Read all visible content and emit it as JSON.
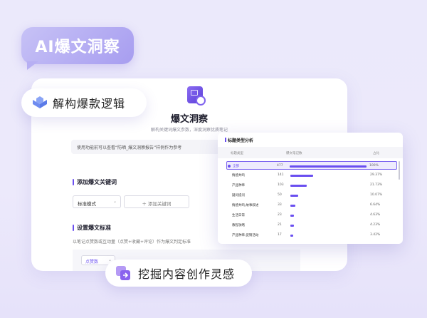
{
  "tag": {
    "label": "AI爆文洞察"
  },
  "pills": {
    "deconstruct": "解构爆款逻辑",
    "mine": "挖掘内容创作灵感"
  },
  "app": {
    "title": "爆文洞察",
    "subtitle": "解构关键词爆文参数，深度洞察优质笔记",
    "notice": "使用功能前可以查看“防晒_爆文洞察报告”样例作为参考",
    "section_keyword": "添加爆文关键词",
    "mode_select": "标准模式",
    "add_keyword": "添加关键词",
    "section_standard": "设置爆文标准",
    "standard_desc": "以笔记点赞数或互动量（点赞+收藏+评论）作为爆文判定标准",
    "metric_select": "点赞数"
  },
  "card": {
    "title": "标题类型分析",
    "headers": [
      "标题类型",
      "爆文笔记数",
      "占比"
    ],
    "rows": [
      {
        "label": "全部",
        "count": "477",
        "pct": "100%",
        "ratio": 1.0,
        "selected": true
      },
      {
        "label": "情感共鸣",
        "count": "141",
        "pct": "29.37%",
        "ratio": 0.2937,
        "selected": false
      },
      {
        "label": "产品种草",
        "count": "103",
        "pct": "21.73%",
        "ratio": 0.2173,
        "selected": false
      },
      {
        "label": "疑问提问",
        "count": "50",
        "pct": "10.07%",
        "ratio": 0.1007,
        "selected": false
      },
      {
        "label": "情感共鸣,故事叙述",
        "count": "33",
        "pct": "6.64%",
        "ratio": 0.0664,
        "selected": false
      },
      {
        "label": "生活日常",
        "count": "23",
        "pct": "4.63%",
        "ratio": 0.0463,
        "selected": false
      },
      {
        "label": "教程攻略",
        "count": "21",
        "pct": "4.23%",
        "ratio": 0.0423,
        "selected": false
      },
      {
        "label": "产品种草,促销活动",
        "count": "17",
        "pct": "3.42%",
        "ratio": 0.0342,
        "selected": false
      }
    ]
  },
  "colors": {
    "accent": "#6a4ff0",
    "background": "#ebe9fb"
  }
}
